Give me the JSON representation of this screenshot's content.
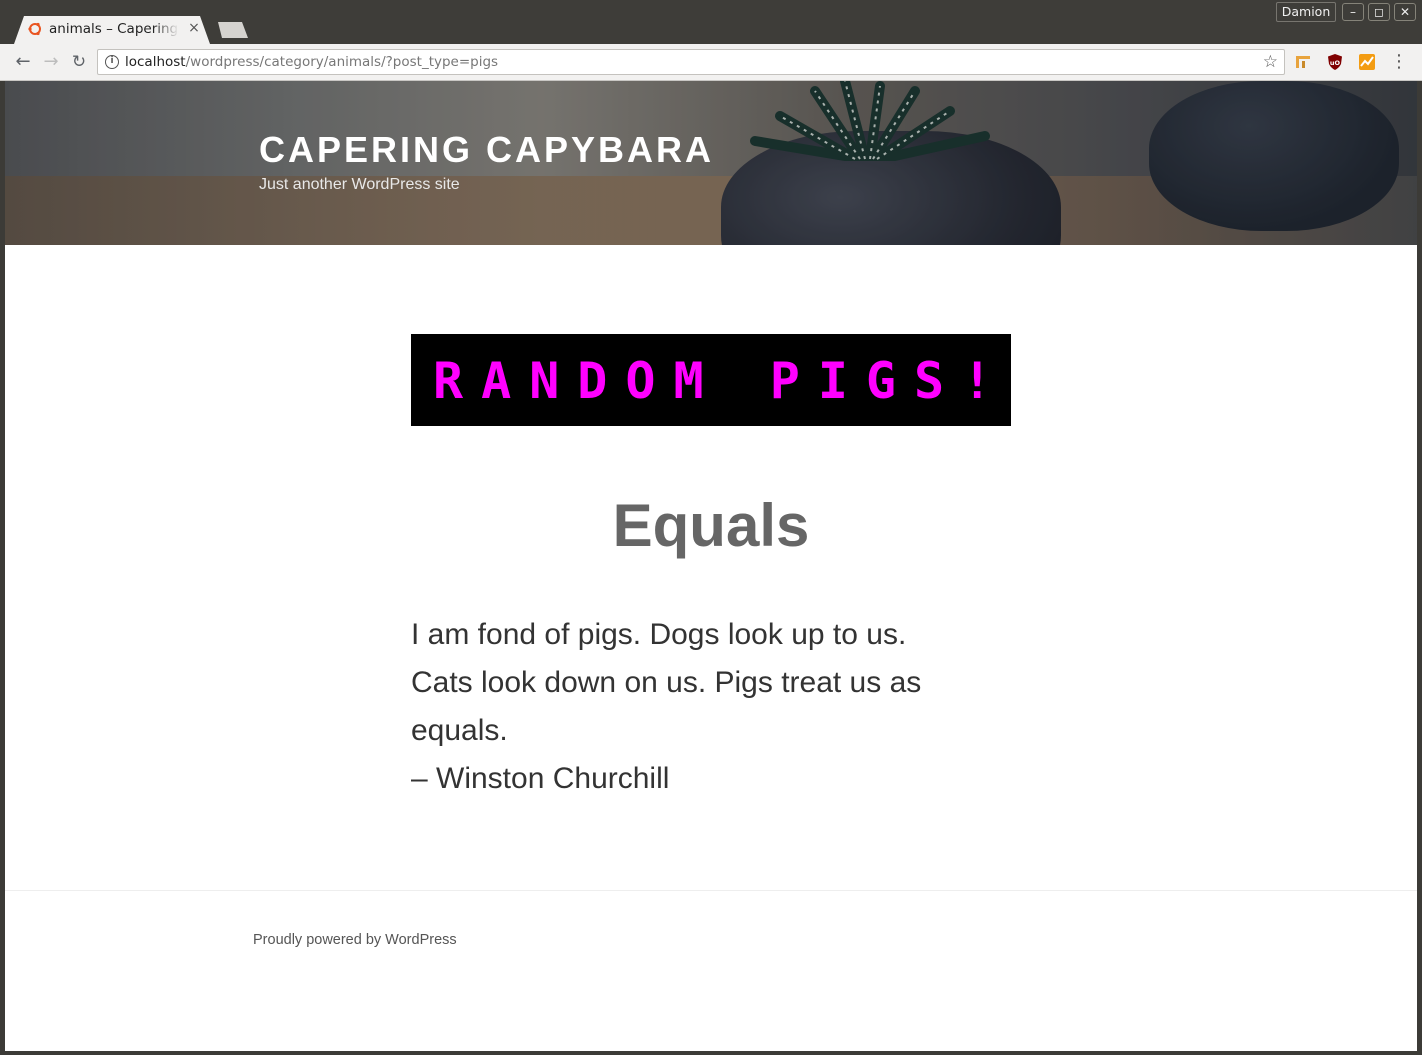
{
  "browser": {
    "tab": {
      "title": "animals – Capering Capybara",
      "close_glyph": "×"
    },
    "profile_name": "Damion",
    "window_buttons": {
      "minimize": "–",
      "maximize": "◻",
      "close": "✕"
    },
    "nav": {
      "back": "←",
      "forward": "→",
      "reload": "↻"
    },
    "address": {
      "host": "localhost",
      "path": "/wordpress/category/animals/?post_type=pigs"
    },
    "icons": [
      "info-icon",
      "bookmark-star-icon",
      "extension-icon",
      "ublock-shield-icon",
      "graph-extension-icon",
      "menu-dots-icon"
    ]
  },
  "site": {
    "title": "CAPERING CAPYBARA",
    "description": "Just another WordPress site"
  },
  "post": {
    "banner_text": "RANDOM PIGS!",
    "banner_text_color": "#ff00ff",
    "title": "Equals",
    "body_lines": [
      "I am fond of pigs. Dogs look up to us.",
      "Cats look down on us. Pigs treat us as",
      "equals.",
      "– Winston Churchill"
    ]
  },
  "footer": {
    "credit": "Proudly powered by WordPress"
  }
}
